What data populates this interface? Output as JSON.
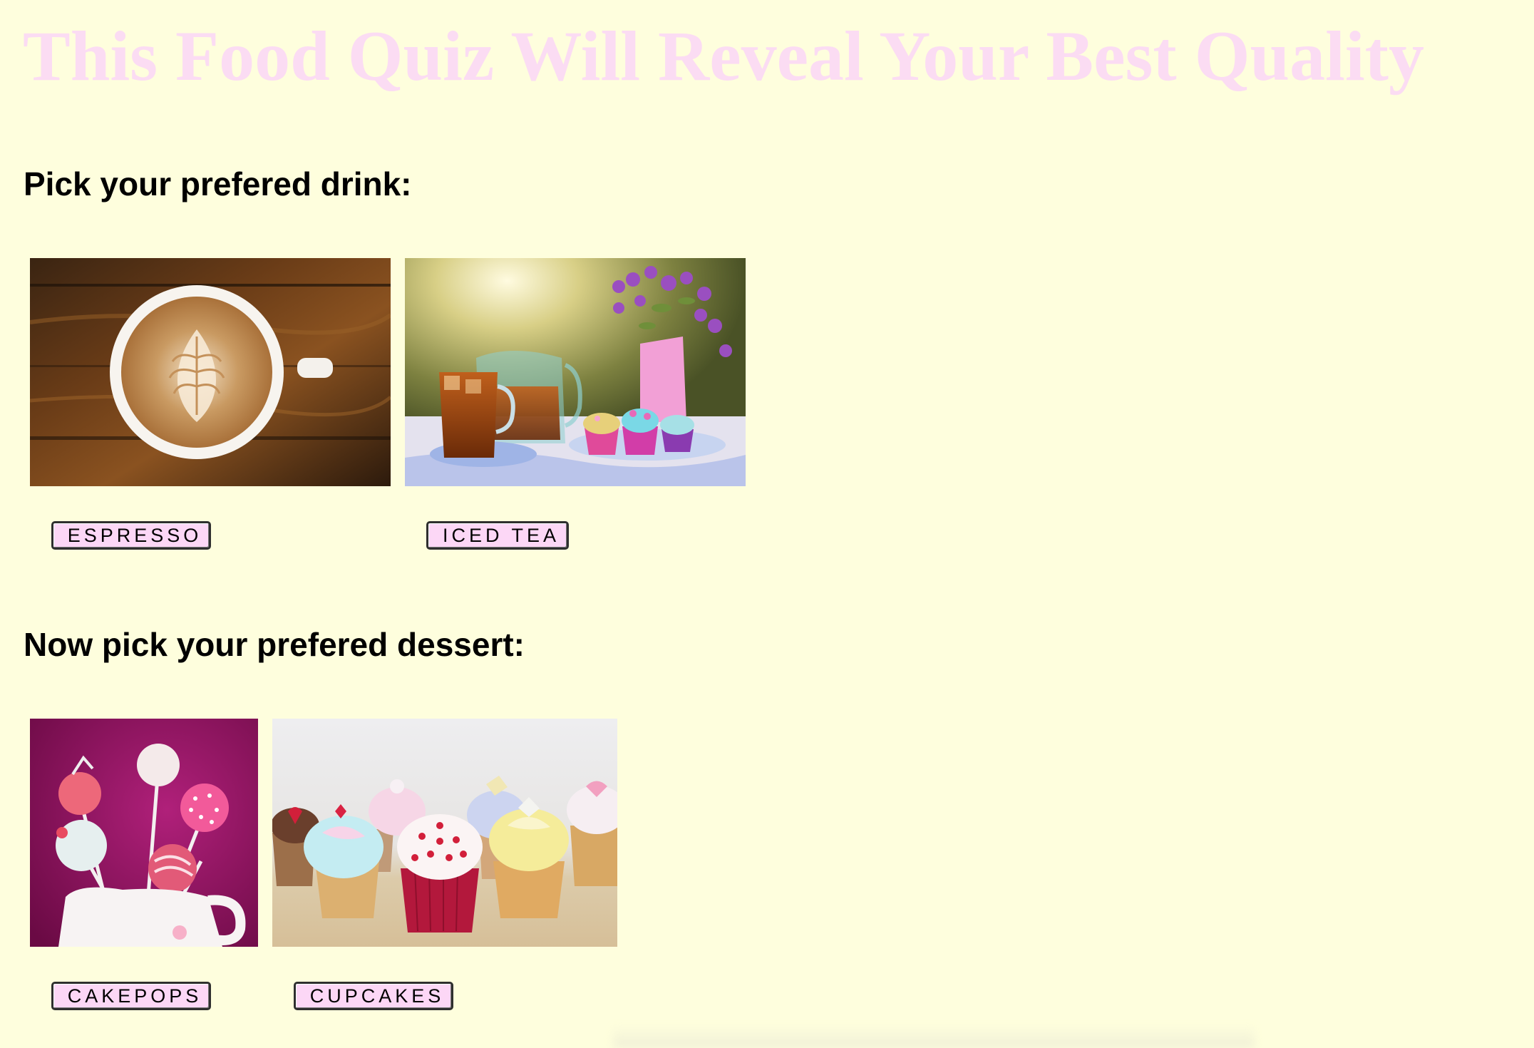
{
  "page": {
    "title": "This Food Quiz Will Reveal Your Best Quality",
    "background": "#fefedd",
    "title_color": "#fbdcf3",
    "button_color": "#fcd7f6"
  },
  "drinks": {
    "heading": "Pick your prefered drink:",
    "options": [
      {
        "label": "ESPRESSO",
        "image": "latte-art-coffee-cup-photo"
      },
      {
        "label": "ICED TEA",
        "image": "iced-tea-and-cupcakes-photo"
      }
    ]
  },
  "desserts": {
    "heading": "Now pick your prefered dessert:",
    "options": [
      {
        "label": "CAKEPOPS",
        "image": "cake-pops-photo"
      },
      {
        "label": "CUPCAKES",
        "image": "cupcakes-photo"
      }
    ]
  }
}
